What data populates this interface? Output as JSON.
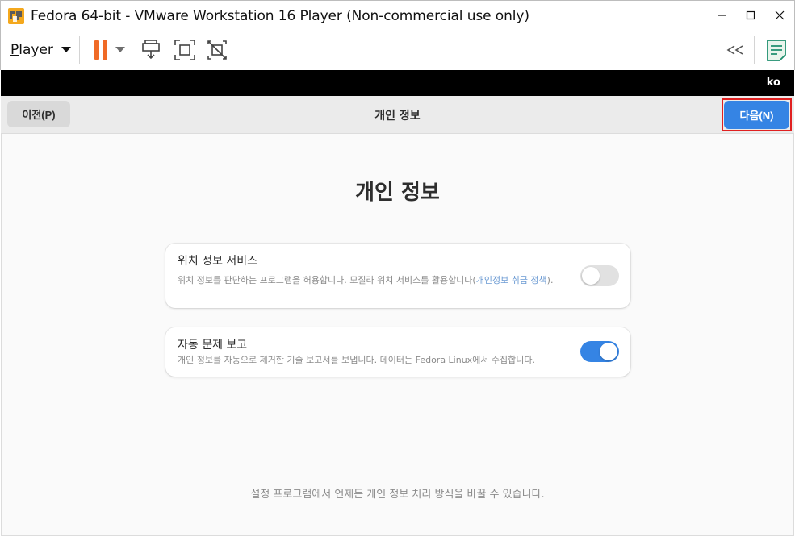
{
  "window": {
    "title": "Fedora 64-bit - VMware Workstation 16 Player (Non-commercial use only)",
    "buttons": [
      "minimize",
      "maximize",
      "close"
    ]
  },
  "toolbar": {
    "player_menu_first": "P",
    "player_menu_rest": "layer",
    "icons": [
      "pause-icon",
      "send-ctrl-alt-del-icon",
      "full-screen-icon",
      "unity-icon",
      "collapse-toolbar-icon",
      "message-log-icon"
    ],
    "pause_color": "#f06a26",
    "message_icon_color": "#1f8f6e"
  },
  "status_strip": {
    "keyboard_layout": "ko"
  },
  "guest_header": {
    "back_label": "이전(P)",
    "title": "개인 정보",
    "next_label": "다음(N)"
  },
  "page": {
    "heading": "개인 정보",
    "location": {
      "title": "위치 정보 서비스",
      "desc_main": "위치 정보를 판단하는 프로그램을 허용합니다. 모질라 위치 서비스를 활용합니다(",
      "desc_link": "개인정보 취급 정책",
      "desc_end": ").",
      "enabled": false
    },
    "report": {
      "title": "자동 문제 보고",
      "desc": "개인 정보를 자동으로 제거한 기술 보고서를 보냅니다. 데이터는 Fedora Linux에서 수집합니다.",
      "enabled": true
    },
    "footer": "설정 프로그램에서 언제든 개인 정보 처리 방식을 바꿀 수 있습니다."
  },
  "colors": {
    "accent": "#3584e4",
    "highlight_outline": "#e02020"
  }
}
